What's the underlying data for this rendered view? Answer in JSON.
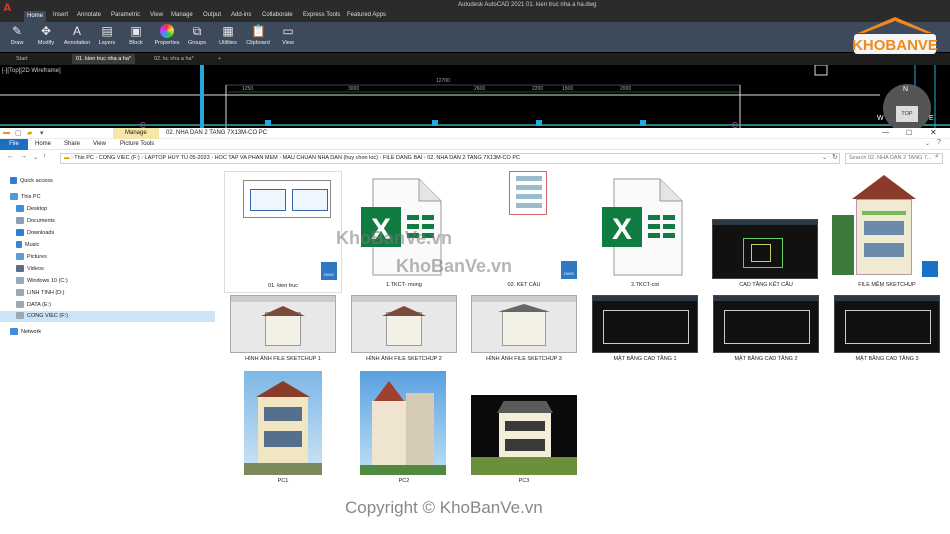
{
  "autocad": {
    "title": "Autodesk AutoCAD 2021    01. kien truc nha a ha.dwg",
    "menu": [
      "Home",
      "Insert",
      "Annotate",
      "Parametric",
      "View",
      "Manage",
      "Output",
      "Add-ins",
      "Collaborate",
      "Express Tools",
      "Featured Apps"
    ],
    "ribbon": [
      "Draw",
      "Modify",
      "Annotation",
      "Layers",
      "Block",
      "Properties",
      "Groups",
      "Utilities",
      "Clipboard",
      "View"
    ],
    "doc_tabs": [
      "Start",
      "01. kien truc nha a ha*",
      "02. kc nha a ha*"
    ],
    "viewport_label": "[-][Top][2D Wireframe]",
    "viewcube": {
      "n": "N",
      "w": "W",
      "e": "E",
      "top": "TOP"
    },
    "dims": [
      "1250",
      "3000",
      "2600",
      "2200",
      "1500",
      "2000",
      "12700"
    ]
  },
  "logo": {
    "text": "KHOBANVE"
  },
  "explorer": {
    "manage_tab": "Manage",
    "window_name": "02. NHA DAN 2 TANG 7X13M-CO PC",
    "tabs": [
      "File",
      "Home",
      "Share",
      "View",
      "Picture Tools"
    ],
    "address": [
      "This PC",
      "CONG VIEC (F:)",
      "LAPTOP HUY TU 05-2023",
      "HOC TAP VA PHAN MEM",
      "MAU CHUAN NHA DAN (huy chon loc)",
      "FILE DANG BAI",
      "02. NHA DAN 2 TANG 7X13M-CO PC"
    ],
    "search_placeholder": "Search 02. NHA DAN 2 TANG 7...",
    "sidebar": [
      "Quick access",
      "This PC",
      "Desktop",
      "Documents",
      "Downloads",
      "Music",
      "Pictures",
      "Videos",
      "Windows 10 (C:)",
      "LINH TINH (D:)",
      "DATA (E:)",
      "CONG VIEC (F:)",
      "Network"
    ],
    "files": [
      "01. kien truc",
      "1.TKCT- mong",
      "02. KET CAU",
      "2.TKCT-cot",
      "CAD TẦNG KẾT CẤU",
      "FILE MỀM SKETCHUP",
      "HÌNH ẢNH FILE SKETCHUP 1",
      "HÌNH ẢNH FILE SKETCHUP 2",
      "HÌNH ẢNH FILE SKETCHUP 3",
      "MẶT BẰNG CAD TẦNG 1",
      "MẶT BẰNG CAD TẦNG 2",
      "MẶT BẰNG CAD TẦNG 3",
      "PC1",
      "PC2",
      "PC3"
    ],
    "dwg_badge": "DWG"
  },
  "watermarks": [
    "KhoBanVe.vn",
    "KhoBanVe.vn"
  ],
  "copyright": "Copyright © KhoBanVe.vn"
}
